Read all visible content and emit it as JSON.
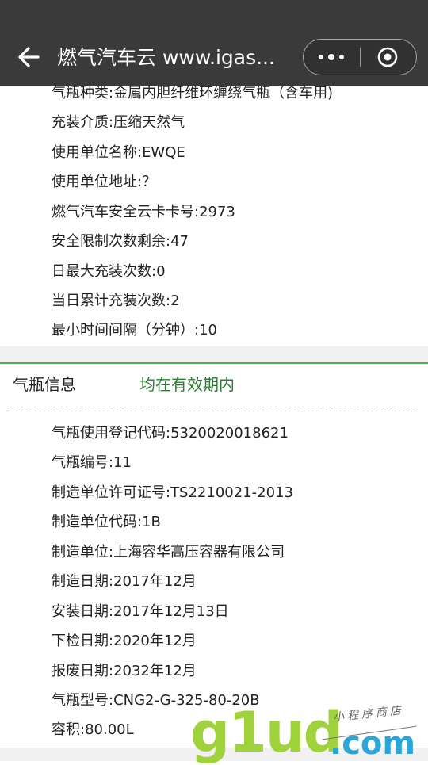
{
  "navbar": {
    "title": "燃气汽车云 www.igas..."
  },
  "basic_info": [
    "气瓶种类:金属内胆纤维环缠绕气瓶（含车用)",
    "充装介质:压缩天然气",
    "使用单位名称:EWQE",
    "使用单位地址:？",
    "燃气汽车安全云卡卡号:2973",
    "安全限制次数剩余:47",
    "日最大充装次数:0",
    "当日累计充装次数:2",
    "最小时间间隔（分钟）:10"
  ],
  "cylinder_header": {
    "label": "气瓶信息",
    "status": "均在有效期内"
  },
  "cylinder_info": [
    "气瓶使用登记代码:5320020018621",
    "气瓶编号:11",
    "制造单位许可证号:TS2210021-2013",
    "制造单位代码:1B",
    "制造单位:上海容华高压容器有限公司",
    "制造日期:2017年12月",
    "安装日期:2017年12月13日",
    "下检日期:2020年12月",
    "报废日期:2032年12月",
    "气瓶型号:CNG2-G-325-80-20B",
    "容积:80.00L"
  ],
  "watermark": {
    "brand": "g1ud",
    "tld": ".com",
    "tagline": "小程序商店"
  },
  "colors": {
    "navbar": "#3a3a3a",
    "status_green": "#2e7d32",
    "accent_line": "#4caf50",
    "band": "#f1f1f1"
  }
}
